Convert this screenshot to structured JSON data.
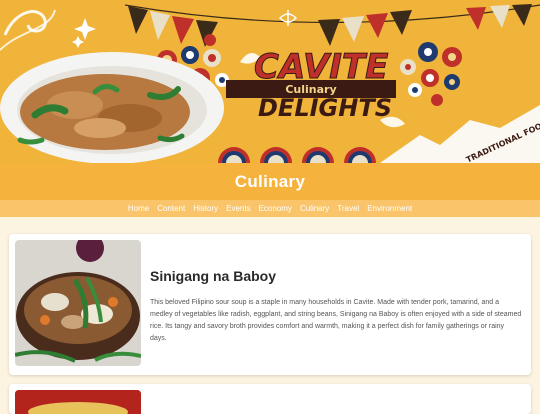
{
  "banner": {
    "logo_line1": "CAVITE",
    "logo_line2": "Culinary",
    "logo_line3": "DELIGHTS",
    "tag": "TRADITIONAL FOODS"
  },
  "page": {
    "title": "Culinary"
  },
  "nav": {
    "items": [
      {
        "label": "Home"
      },
      {
        "label": "Content"
      },
      {
        "label": "History"
      },
      {
        "label": "Events"
      },
      {
        "label": "Economy"
      },
      {
        "label": "Culinary"
      },
      {
        "label": "Travel"
      },
      {
        "label": "Environment"
      }
    ]
  },
  "cards": [
    {
      "title": "Sinigang na Baboy",
      "description": "This beloved Filipino sour soup is a staple in many households in Cavite. Made with tender pork, tamarind, and a medley of vegetables like radish, eggplant, and string beans, Sinigang na Baboy is often enjoyed with a side of steamed rice. Its tangy and savory broth provides comfort and warmth, making it a perfect dish for family gatherings or rainy days."
    }
  ],
  "colors": {
    "orange": "#f0b43a",
    "nav": "#f9c46a",
    "red": "#c0302a",
    "navy": "#1e3a6e"
  }
}
